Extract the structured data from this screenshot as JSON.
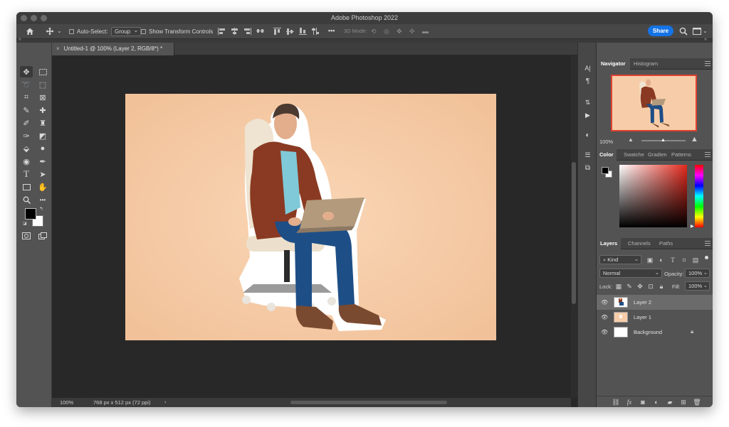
{
  "window": {
    "title": "Adobe Photoshop 2022"
  },
  "options_bar": {
    "auto_select_label": "Auto-Select:",
    "auto_select_value": "Group",
    "show_transform_label": "Show Transform Controls",
    "mode_3d_label": "3D Mode:",
    "more_label": "•••",
    "share_label": "Share"
  },
  "tools": [
    "move-tool",
    "marquee-tool",
    "lasso-tool",
    "object-select-tool",
    "crop-tool",
    "frame-tool",
    "eyedropper-tool",
    "healing-brush-tool",
    "brush-tool",
    "clone-stamp-tool",
    "history-brush-tool",
    "eraser-tool",
    "paint-bucket-tool",
    "blur-tool",
    "dodge-tool",
    "pen-tool",
    "type-tool",
    "path-select-tool",
    "rectangle-tool",
    "hand-tool",
    "zoom-tool",
    "more-tools"
  ],
  "colors": {
    "foreground": "#000000",
    "background": "#ffffff",
    "canvas_bg": "#f7cda9",
    "accent": "#1473e6"
  },
  "document": {
    "tab_title": "Untitled-1 @ 100% (Layer 2, RGB/8*) *",
    "zoom": "100%",
    "dimensions": "768 px x 512 px (72 ppi)",
    "status_arrow": "›"
  },
  "navigator_panel": {
    "tabs": [
      "Navigator",
      "Histogram"
    ],
    "zoom": "100%",
    "zoom_slider_fraction": 0.5
  },
  "color_panel": {
    "tabs": [
      "Color",
      "Swatche",
      "Gradien",
      "Patterns"
    ]
  },
  "layers_panel": {
    "tabs": [
      "Layers",
      "Channels",
      "Paths"
    ],
    "kind_filter": "Kind",
    "blend_mode": "Normal",
    "opacity_label": "Opacity:",
    "opacity_value": "100%",
    "lock_label": "Lock:",
    "fill_label": "Fill:",
    "fill_value": "100%",
    "layers": [
      {
        "name": "Layer 2",
        "selected": true
      },
      {
        "name": "Layer 1",
        "selected": false
      },
      {
        "name": "Background",
        "selected": false,
        "locked": true
      }
    ],
    "footer_fx": "fx"
  }
}
